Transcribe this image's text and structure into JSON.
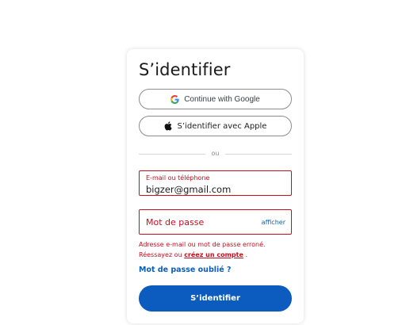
{
  "login": {
    "title": "S’identifier",
    "google_label": "Continue with Google",
    "apple_label": "S’identifier avec Apple",
    "divider_text": "ou",
    "email_label": "E-mail ou téléphone",
    "email_value": "bigzer@gmail.com",
    "password_placeholder": "Mot de passe",
    "show_password_label": "afficher",
    "error_line1": "Adresse e-mail ou mot de passe erroné.",
    "error_line2_prefix": "Réessayez ou ",
    "error_create_link": "créez un compte",
    "error_line2_suffix": " .",
    "forgot_label": "Mot de passe oublié ?",
    "submit_label": "S’identifier"
  },
  "colors": {
    "error": "#c50f1f",
    "link": "#0e5eb6",
    "primary_button": "#0b5cbe"
  },
  "icons": {
    "google": "google-g-icon",
    "apple": "apple-logo-icon"
  }
}
